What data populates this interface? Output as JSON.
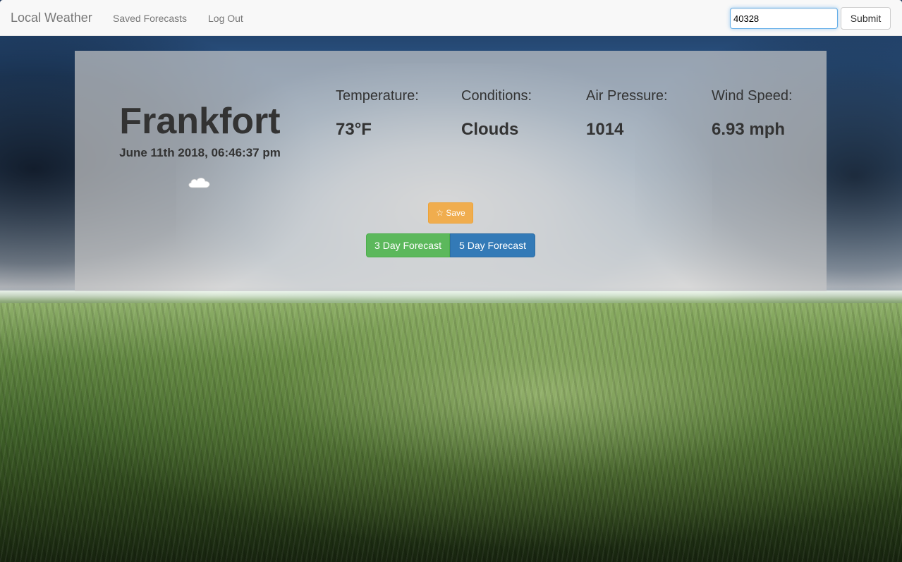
{
  "navbar": {
    "brand": "Local Weather",
    "links": [
      "Saved Forecasts",
      "Log Out"
    ],
    "search": {
      "value": "40328",
      "submit_label": "Submit"
    }
  },
  "weather": {
    "city": "Frankfort",
    "datetime": "June 11th 2018, 06:46:37 pm",
    "icon": "cloud-icon",
    "stats": [
      {
        "label": "Temperature:",
        "value": "73°F"
      },
      {
        "label": "Conditions:",
        "value": "Clouds"
      },
      {
        "label": "Air Pressure:",
        "value": "1014"
      },
      {
        "label": "Wind Speed:",
        "value": "6.93 mph"
      }
    ],
    "save_label": "☆ Save",
    "forecast_buttons": [
      "3 Day Forecast",
      "5 Day Forecast"
    ]
  },
  "colors": {
    "save": "#f0ad4e",
    "three_day": "#5cb85c",
    "five_day": "#337ab7"
  }
}
